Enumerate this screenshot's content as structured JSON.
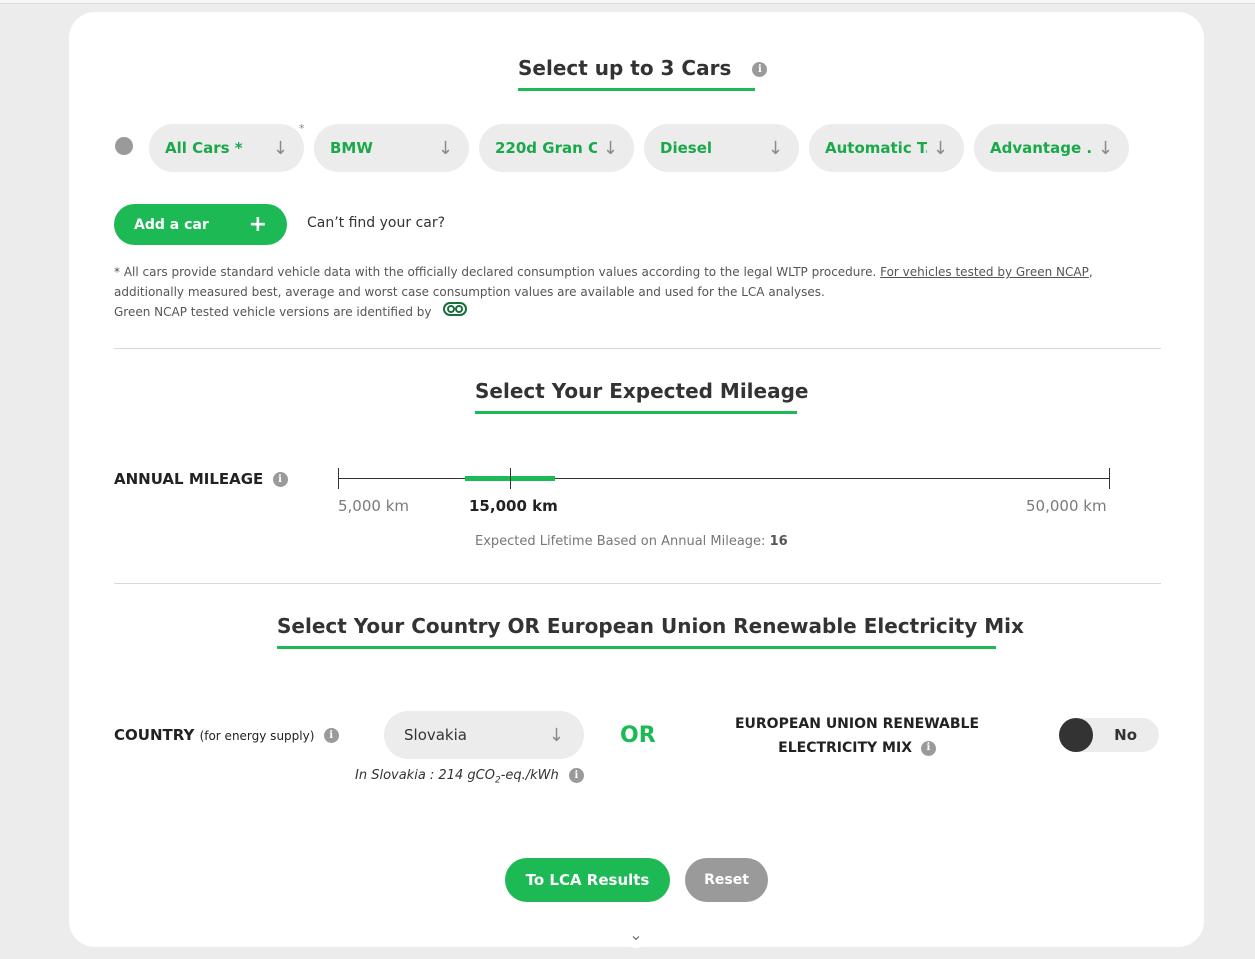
{
  "cars_section": {
    "title": "Select up to 3 Cars",
    "selector": {
      "category": "All Cars *",
      "make": "BMW",
      "model": "220d Gran C...",
      "fuel": "Diesel",
      "transmission": "Automatic T...",
      "trim": "Advantage ..."
    },
    "add_car_label": "Add a car",
    "cant_find": "Can’t find your car?",
    "note_line1": "* All cars provide standard vehicle data with the officially declared consumption values according to the legal WLTP procedure.",
    "note_link": "For vehicles tested by Green NCAP",
    "note_line1_end": ",",
    "note_line2": "additionally measured best, average and worst case consumption values are available and used for the LCA analyses.",
    "note_line3": "Green NCAP tested vehicle versions are identified by"
  },
  "mileage_section": {
    "title": "Select Your Expected Mileage",
    "annual_label": "ANNUAL MILEAGE",
    "min_label": "5,000 km",
    "value_label": "15,000 km",
    "max_label": "50,000 km",
    "slider_value_km": 15000,
    "slider_min_km": 5000,
    "slider_max_km": 50000,
    "lifetime_text": "Expected Lifetime Based on Annual Mileage:",
    "lifetime_value": "16"
  },
  "energy_section": {
    "title": "Select Your Country OR European Union Renewable Electricity Mix",
    "country_label": "COUNTRY",
    "country_sub": "(for energy supply)",
    "country_value": "Slovakia",
    "intensity_prefix": "In Slovakia : 214 gCO",
    "intensity_sub": "2",
    "intensity_suffix": "-eq./kWh",
    "or_label": "OR",
    "eu_label_line1": "EUROPEAN UNION RENEWABLE",
    "eu_label_line2": "ELECTRICITY MIX",
    "eu_toggle_value": "No"
  },
  "actions": {
    "results_label": "To LCA Results",
    "reset_label": "Reset"
  },
  "colors": {
    "accent": "#1db954",
    "pill_bg": "#ececec",
    "muted": "#9a9a9a"
  }
}
